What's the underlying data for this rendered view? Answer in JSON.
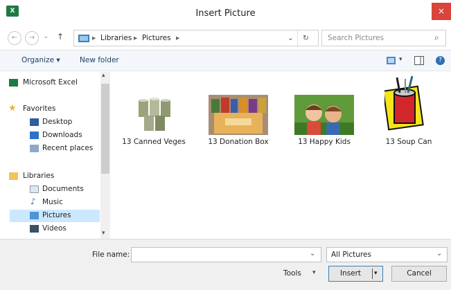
{
  "window": {
    "title": "Insert Picture",
    "app_icon_text": "X",
    "close_glyph": "×"
  },
  "nav": {
    "back_glyph": "←",
    "forward_glyph": "→",
    "dropdown_glyph": "⌄",
    "up_glyph": "↑",
    "breadcrumbs": [
      "Libraries",
      "Pictures"
    ],
    "separator": "▸",
    "address_dropdown_glyph": "⌄",
    "refresh_glyph": "↻",
    "search_placeholder": "Search Pictures",
    "search_glyph": "⌕"
  },
  "toolbar": {
    "organize_label": "Organize ▾",
    "new_folder_label": "New folder",
    "view_dropdown_glyph": "▾",
    "help_glyph": "?"
  },
  "sidebar": {
    "scroll_up_glyph": "▴",
    "scroll_down_glyph": "▾",
    "items": [
      {
        "label": "Microsoft Excel"
      },
      {
        "label": "Favorites"
      },
      {
        "label": "Desktop"
      },
      {
        "label": "Downloads"
      },
      {
        "label": "Recent places"
      },
      {
        "label": "Libraries"
      },
      {
        "label": "Documents"
      },
      {
        "label": "Music"
      },
      {
        "label": "Pictures"
      },
      {
        "label": "Videos"
      }
    ]
  },
  "files": [
    {
      "name": "13 Canned Veges"
    },
    {
      "name": "13 Donation Box"
    },
    {
      "name": "13 Happy Kids"
    },
    {
      "name": "13 Soup Can"
    }
  ],
  "footer": {
    "file_name_label": "File name:",
    "file_name_value": "",
    "file_dropdown_glyph": "⌄",
    "filter_value": "All Pictures",
    "filter_dropdown_glyph": "⌄",
    "tools_label": "Tools",
    "tools_dropdown_glyph": "▾",
    "insert_label": "Insert",
    "insert_split_glyph": "▾",
    "cancel_label": "Cancel"
  }
}
